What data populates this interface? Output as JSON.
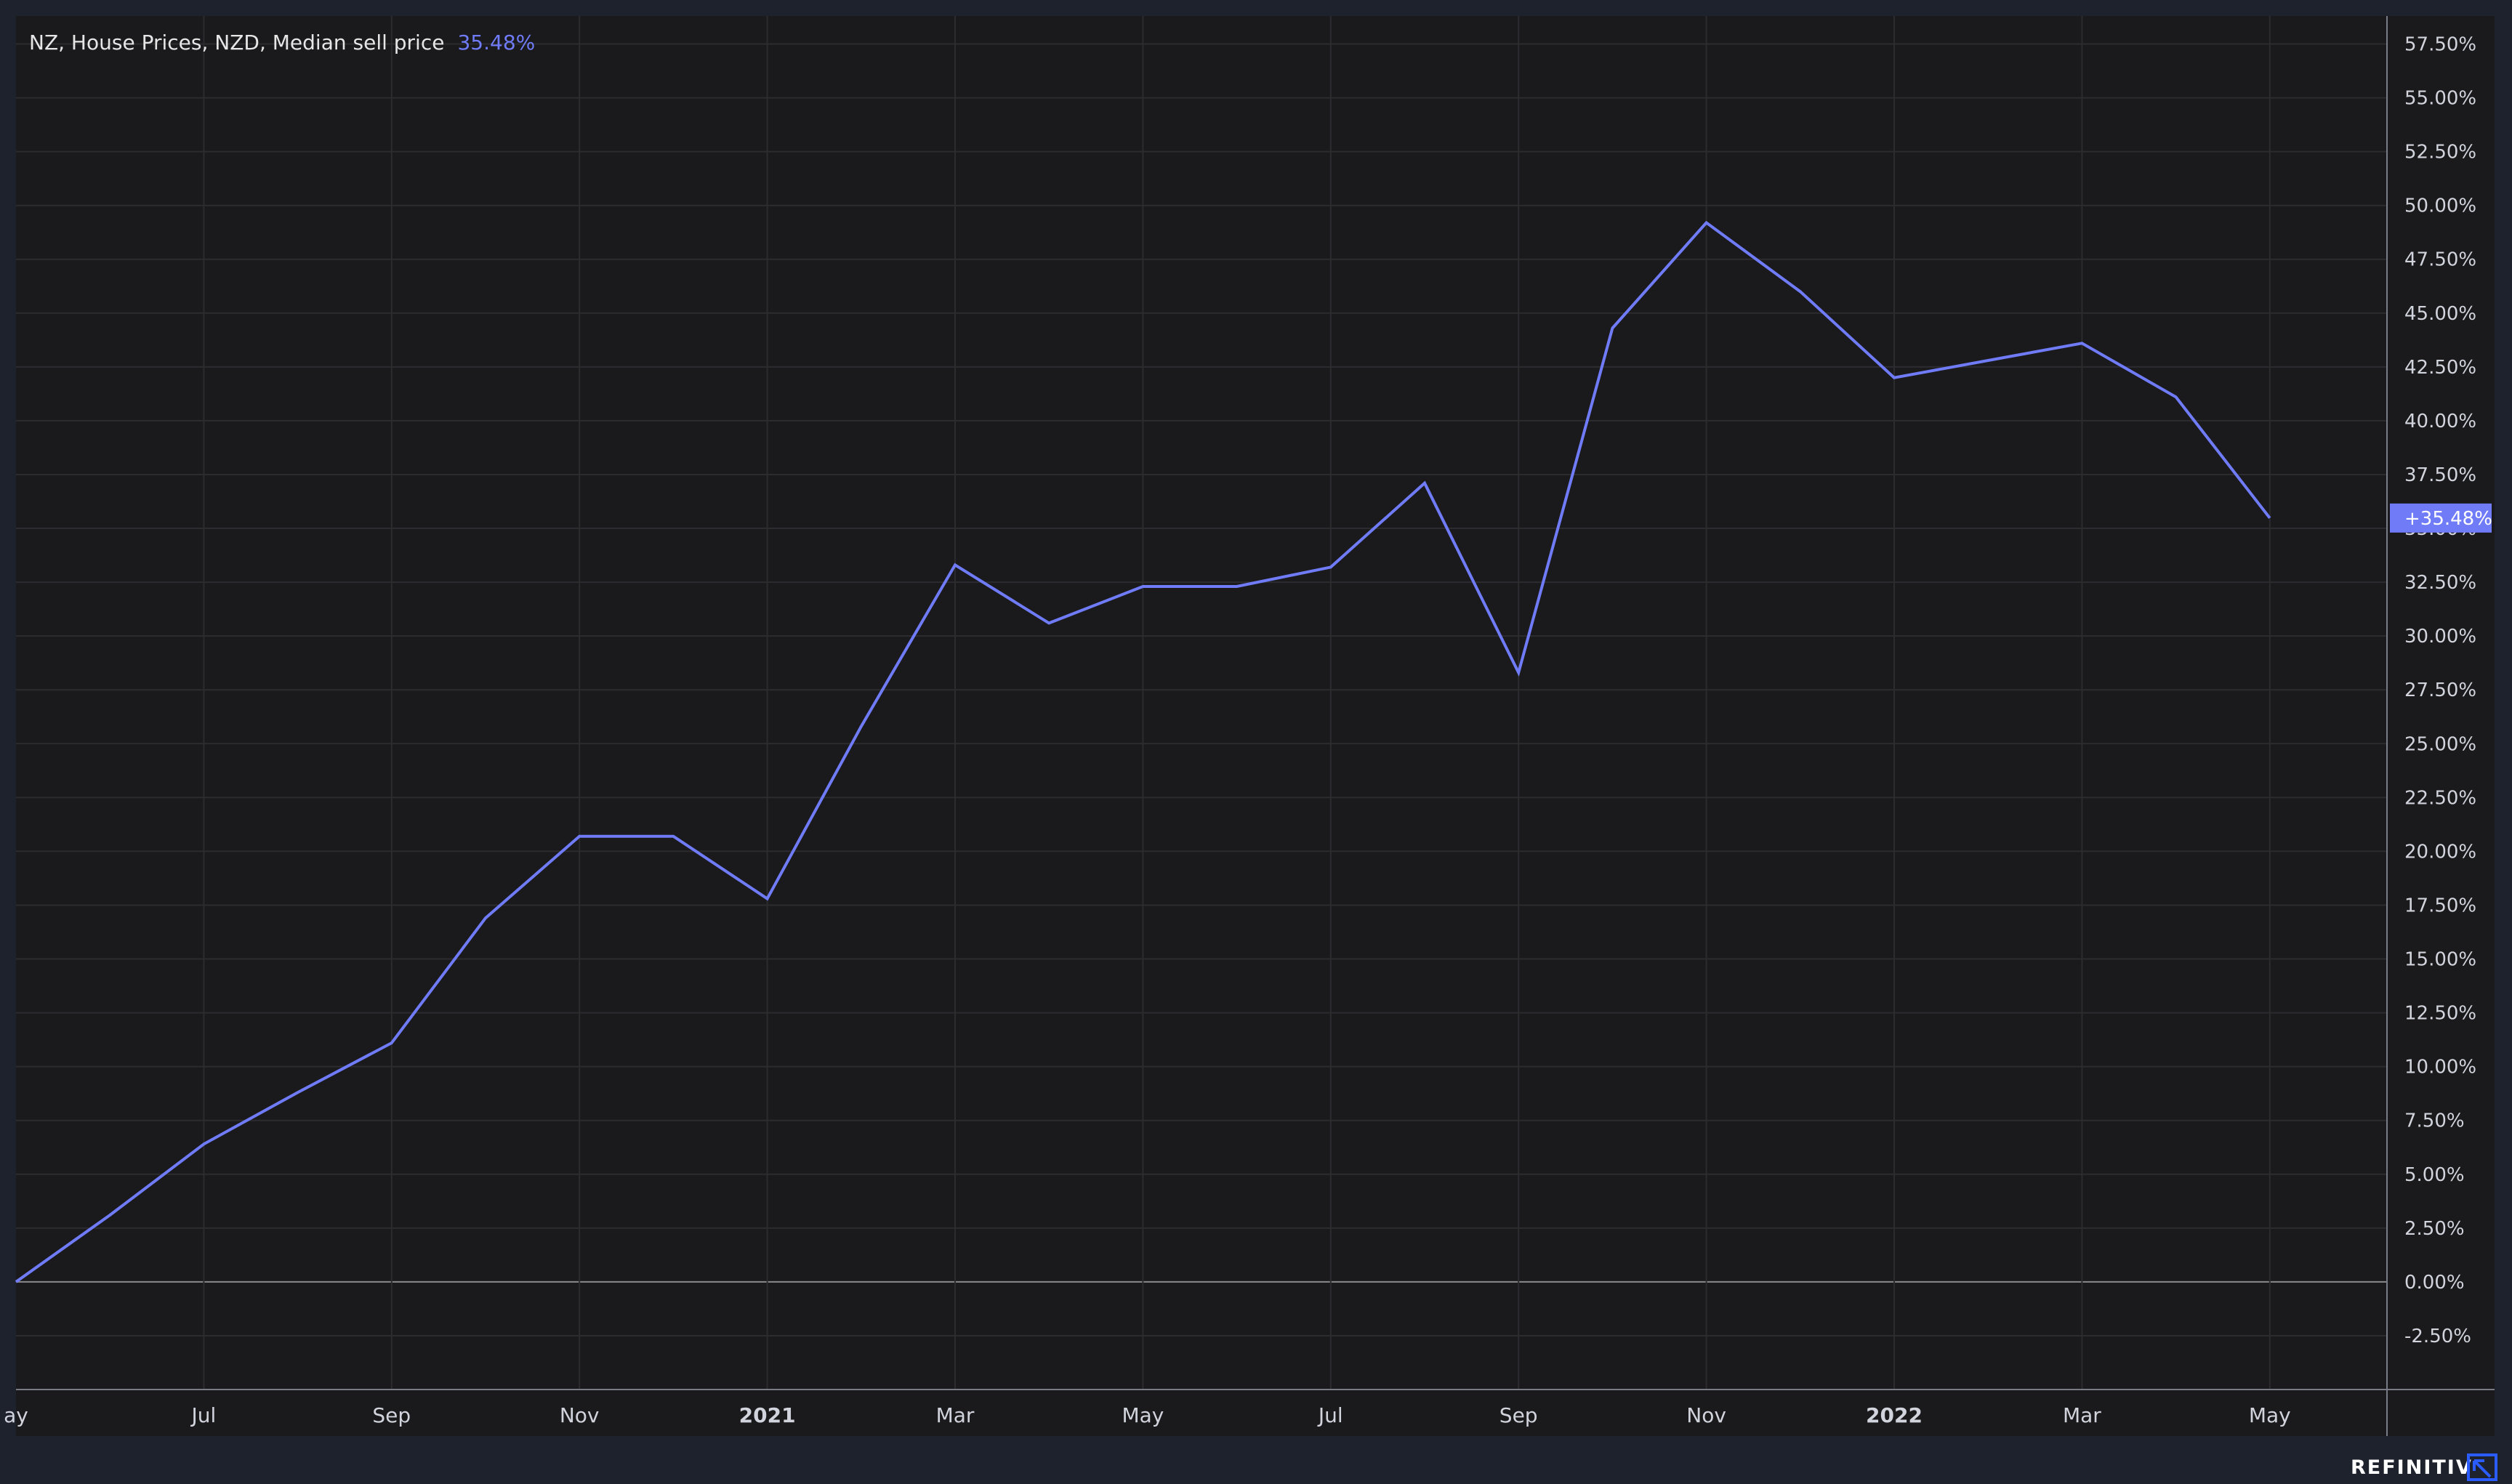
{
  "chart_data": {
    "type": "line",
    "legend": {
      "name": "NZ, House Prices, NZD, Median sell price",
      "value": "35.48%"
    },
    "last_value_label": "+35.48%",
    "x": [
      "2020-05",
      "2020-06",
      "2020-07",
      "2020-08",
      "2020-09",
      "2020-10",
      "2020-11",
      "2020-12",
      "2021-01",
      "2021-02",
      "2021-03",
      "2021-04",
      "2021-05",
      "2021-06",
      "2021-07",
      "2021-08",
      "2021-09",
      "2021-10",
      "2021-11",
      "2021-12",
      "2022-01",
      "2022-02",
      "2022-03",
      "2022-04",
      "2022-05"
    ],
    "series": [
      {
        "values": [
          0.0,
          3.1,
          6.4,
          8.8,
          11.1,
          16.9,
          20.7,
          20.7,
          17.8,
          25.8,
          33.3,
          30.6,
          32.3,
          32.3,
          33.2,
          37.1,
          28.3,
          44.3,
          49.2,
          46.0,
          42.0,
          42.8,
          43.6,
          41.1,
          35.48
        ]
      }
    ],
    "xticks": [
      {
        "label": "ay",
        "x": "2020-05",
        "bold": false
      },
      {
        "label": "Jul",
        "x": "2020-07",
        "bold": false
      },
      {
        "label": "Sep",
        "x": "2020-09",
        "bold": false
      },
      {
        "label": "Nov",
        "x": "2020-11",
        "bold": false
      },
      {
        "label": "2021",
        "x": "2021-01",
        "bold": true
      },
      {
        "label": "Mar",
        "x": "2021-03",
        "bold": false
      },
      {
        "label": "May",
        "x": "2021-05",
        "bold": false
      },
      {
        "label": "Jul",
        "x": "2021-07",
        "bold": false
      },
      {
        "label": "Sep",
        "x": "2021-09",
        "bold": false
      },
      {
        "label": "Nov",
        "x": "2021-11",
        "bold": false
      },
      {
        "label": "2022",
        "x": "2022-01",
        "bold": true
      },
      {
        "label": "Mar",
        "x": "2022-03",
        "bold": false
      },
      {
        "label": "May",
        "x": "2022-05",
        "bold": false
      }
    ],
    "yticks": [
      -2.5,
      0,
      2.5,
      5,
      7.5,
      10,
      12.5,
      15,
      17.5,
      20,
      22.5,
      25,
      27.5,
      30,
      32.5,
      35,
      37.5,
      40,
      42.5,
      45,
      47.5,
      50,
      52.5,
      55,
      57.5
    ],
    "ylim": [
      -5,
      58.8
    ],
    "ytick_format": "percent_2dp",
    "grid": true,
    "colors": {
      "line": "#6f7bf7",
      "background": "#1a1a1c",
      "frame": "#1e222d",
      "grid": "#2c2c30",
      "zero_line": "#8a8a8f",
      "axis": "#787b86",
      "text": "#d1d4dc"
    }
  },
  "brand": {
    "text": "REFINITIV",
    "icon": "refinitiv-arrow-icon"
  }
}
